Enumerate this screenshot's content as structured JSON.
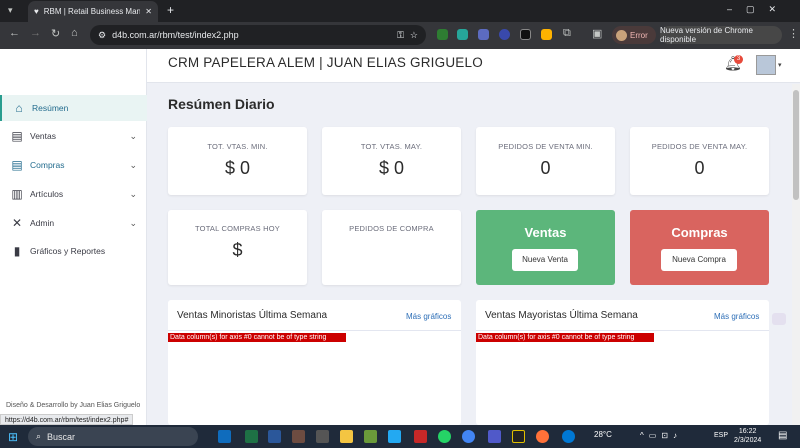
{
  "browser": {
    "tab_title": "RBM | Retail Business Managem",
    "url": "d4b.com.ar/rbm/test/index2.php",
    "error_label": "Error",
    "update_label": "Nueva versión de Chrome disponible",
    "status_url": "https://d4b.com.ar/rbm/test/index2.php#"
  },
  "header": {
    "title": "CRM PAPELERA ALEM | JUAN ELIAS GRIGUELO",
    "notif_count": "3"
  },
  "sidebar": {
    "items": [
      {
        "label": "Resúmen"
      },
      {
        "label": "Ventas"
      },
      {
        "label": "Compras"
      },
      {
        "label": "Artículos"
      },
      {
        "label": "Admin"
      },
      {
        "label": "Gráficos y Reportes"
      }
    ],
    "footer": "Diseño & Desarrollo by Juan Elias Griguelo"
  },
  "main": {
    "title": "Resúmen Diario",
    "cards": [
      {
        "label": "TOT. VTAS. MIN.",
        "value": "$ 0"
      },
      {
        "label": "TOT. VTAS. MAY.",
        "value": "$ 0"
      },
      {
        "label": "PEDIDOS DE VENTA MIN.",
        "value": "0"
      },
      {
        "label": "PEDIDOS DE VENTA MAY.",
        "value": "0"
      },
      {
        "label": "TOTAL COMPRAS HOY",
        "value": "$"
      },
      {
        "label": "PEDIDOS DE COMPRA",
        "value": ""
      }
    ],
    "ventas": {
      "title": "Ventas",
      "button": "Nueva Venta",
      "color": "#5cb67b"
    },
    "compras": {
      "title": "Compras",
      "button": "Nueva Compra",
      "color": "#d9645f"
    },
    "panels": [
      {
        "title": "Ventas Minoristas Última Semana",
        "link": "Más gráficos",
        "error": "Data column(s) for axis #0 cannot be of type string"
      },
      {
        "title": "Ventas Mayoristas Última Semana",
        "link": "Más gráficos",
        "error": "Data column(s) for axis #0 cannot be of type string"
      }
    ]
  },
  "taskbar": {
    "search_placeholder": "Buscar",
    "weather": "28°C",
    "lang": "ESP",
    "time": "16:22",
    "date": "2/3/2024"
  }
}
